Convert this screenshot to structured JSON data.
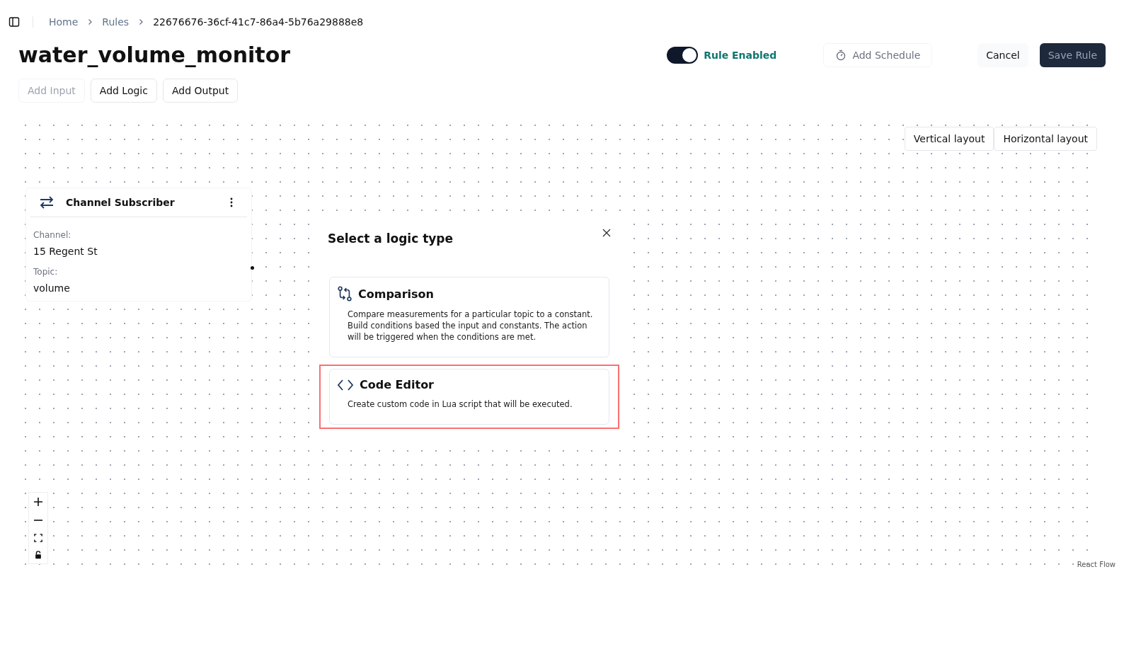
{
  "breadcrumb": [
    "Home",
    "Rules",
    "22676676-36cf-41c7-86a4-5b76a29888e8"
  ],
  "title": "water_volume_monitor",
  "rule_toggle": {
    "label": "Rule Enabled",
    "on": true
  },
  "header_buttons": {
    "schedule": "Add Schedule",
    "cancel": "Cancel",
    "save": "Save Rule"
  },
  "toolbar": [
    {
      "label": "Add Input",
      "disabled": true
    },
    {
      "label": "Add Logic",
      "disabled": false
    },
    {
      "label": "Add Output",
      "disabled": false
    }
  ],
  "layout_buttons": [
    "Vertical layout",
    "Horizontal layout"
  ],
  "node": {
    "title": "Channel Subscriber",
    "fields": [
      {
        "label": "Channel:",
        "value": "15 Regent St"
      },
      {
        "label": "Topic:",
        "value": "volume"
      }
    ]
  },
  "attribution": "React Flow",
  "dialog": {
    "title": "Select a logic type",
    "options": [
      {
        "kind": "comparison",
        "title": "Comparison",
        "description": "Compare measurements for a particular topic to a constant. Build conditions based the input and constants. The action will be triggered when the conditions are met.",
        "highlighted": false
      },
      {
        "kind": "code",
        "title": "Code Editor",
        "description": "Create custom code in Lua script that will be executed.",
        "highlighted": true
      }
    ]
  }
}
